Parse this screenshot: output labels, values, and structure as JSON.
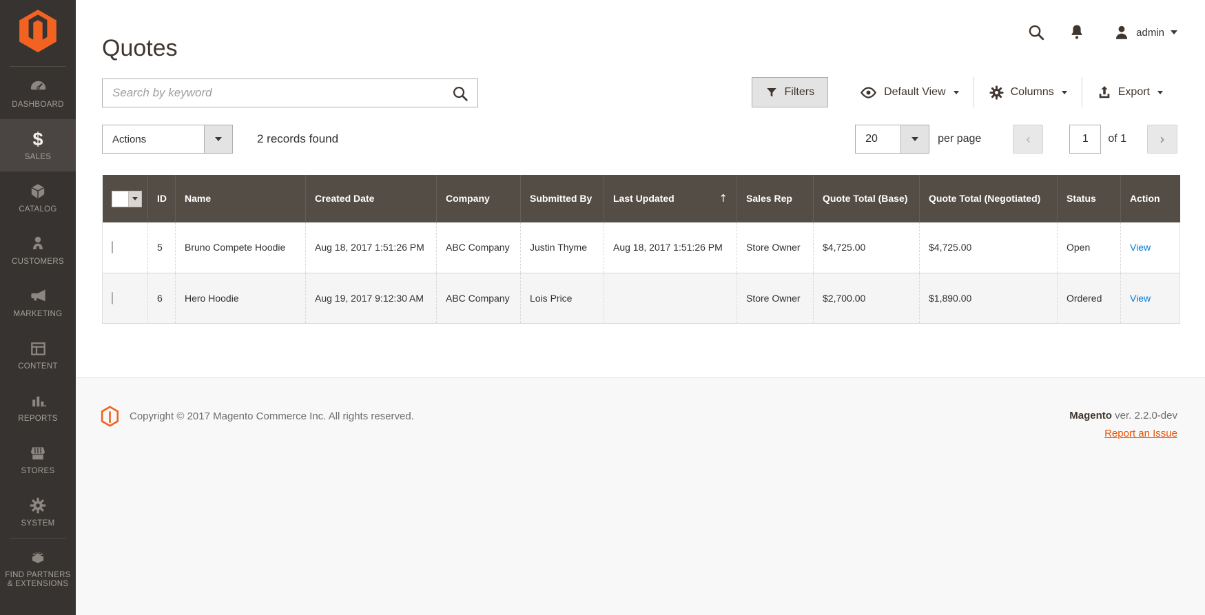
{
  "page_title": "Quotes",
  "header": {
    "admin_label": "admin"
  },
  "sidebar": {
    "items": [
      {
        "label": "DASHBOARD",
        "icon": "dashboard-icon",
        "active": false
      },
      {
        "label": "SALES",
        "icon": "sales-icon",
        "active": true
      },
      {
        "label": "CATALOG",
        "icon": "catalog-icon",
        "active": false
      },
      {
        "label": "CUSTOMERS",
        "icon": "customers-icon",
        "active": false
      },
      {
        "label": "MARKETING",
        "icon": "marketing-icon",
        "active": false
      },
      {
        "label": "CONTENT",
        "icon": "content-icon",
        "active": false
      },
      {
        "label": "REPORTS",
        "icon": "reports-icon",
        "active": false
      },
      {
        "label": "STORES",
        "icon": "stores-icon",
        "active": false
      },
      {
        "label": "SYSTEM",
        "icon": "system-icon",
        "active": false
      },
      {
        "label": "FIND PARTNERS & EXTENSIONS",
        "icon": "find-partners-icon",
        "active": false
      }
    ]
  },
  "toolbar": {
    "search_placeholder": "Search by keyword",
    "filters_label": "Filters",
    "view_label": "Default View",
    "columns_label": "Columns",
    "export_label": "Export"
  },
  "grid_controls": {
    "actions_label": "Actions",
    "records_found": "2 records found",
    "per_page_value": "20",
    "per_page_label": "per page",
    "page_value": "1",
    "page_total_label": "of 1"
  },
  "table": {
    "columns": [
      "ID",
      "Name",
      "Created Date",
      "Company",
      "Submitted By",
      "Last Updated",
      "Sales Rep",
      "Quote Total (Base)",
      "Quote Total (Negotiated)",
      "Status",
      "Action"
    ],
    "sorted_column": "Last Updated",
    "sort_direction": "ascending",
    "sort_glyph": "↑",
    "rows": [
      {
        "id": "5",
        "name": "Bruno Compete Hoodie",
        "created_date": "Aug 18, 2017 1:51:26 PM",
        "company": "ABC Company",
        "submitted_by": "Justin Thyme",
        "last_updated": "Aug 18, 2017 1:51:26 PM",
        "sales_rep": "Store Owner",
        "quote_total_base": "$4,725.00",
        "quote_total_negotiated": "$4,725.00",
        "status": "Open",
        "action": "View"
      },
      {
        "id": "6",
        "name": "Hero Hoodie",
        "created_date": "Aug 19, 2017 9:12:30 AM",
        "company": "ABC Company",
        "submitted_by": "Lois Price",
        "last_updated": "",
        "sales_rep": "Store Owner",
        "quote_total_base": "$2,700.00",
        "quote_total_negotiated": "$1,890.00",
        "status": "Ordered",
        "action": "View"
      }
    ]
  },
  "pagination_glyphs": {
    "prev": "‹",
    "next": "›"
  },
  "footer": {
    "copyright": "Copyright © 2017 Magento Commerce Inc. All rights reserved.",
    "brand": "Magento",
    "version": "ver. 2.2.0-dev",
    "report_link": "Report an Issue"
  },
  "colors": {
    "accent_orange": "#f26322",
    "report_link_orange": "#eb5202",
    "link_blue": "#007bdb",
    "sidebar_bg": "#373330",
    "sidebar_active_bg": "#4a4542",
    "grid_header_bg": "#534d46",
    "zebra_row_bg": "#f5f5f5",
    "footer_bg": "#f8f8f8"
  }
}
